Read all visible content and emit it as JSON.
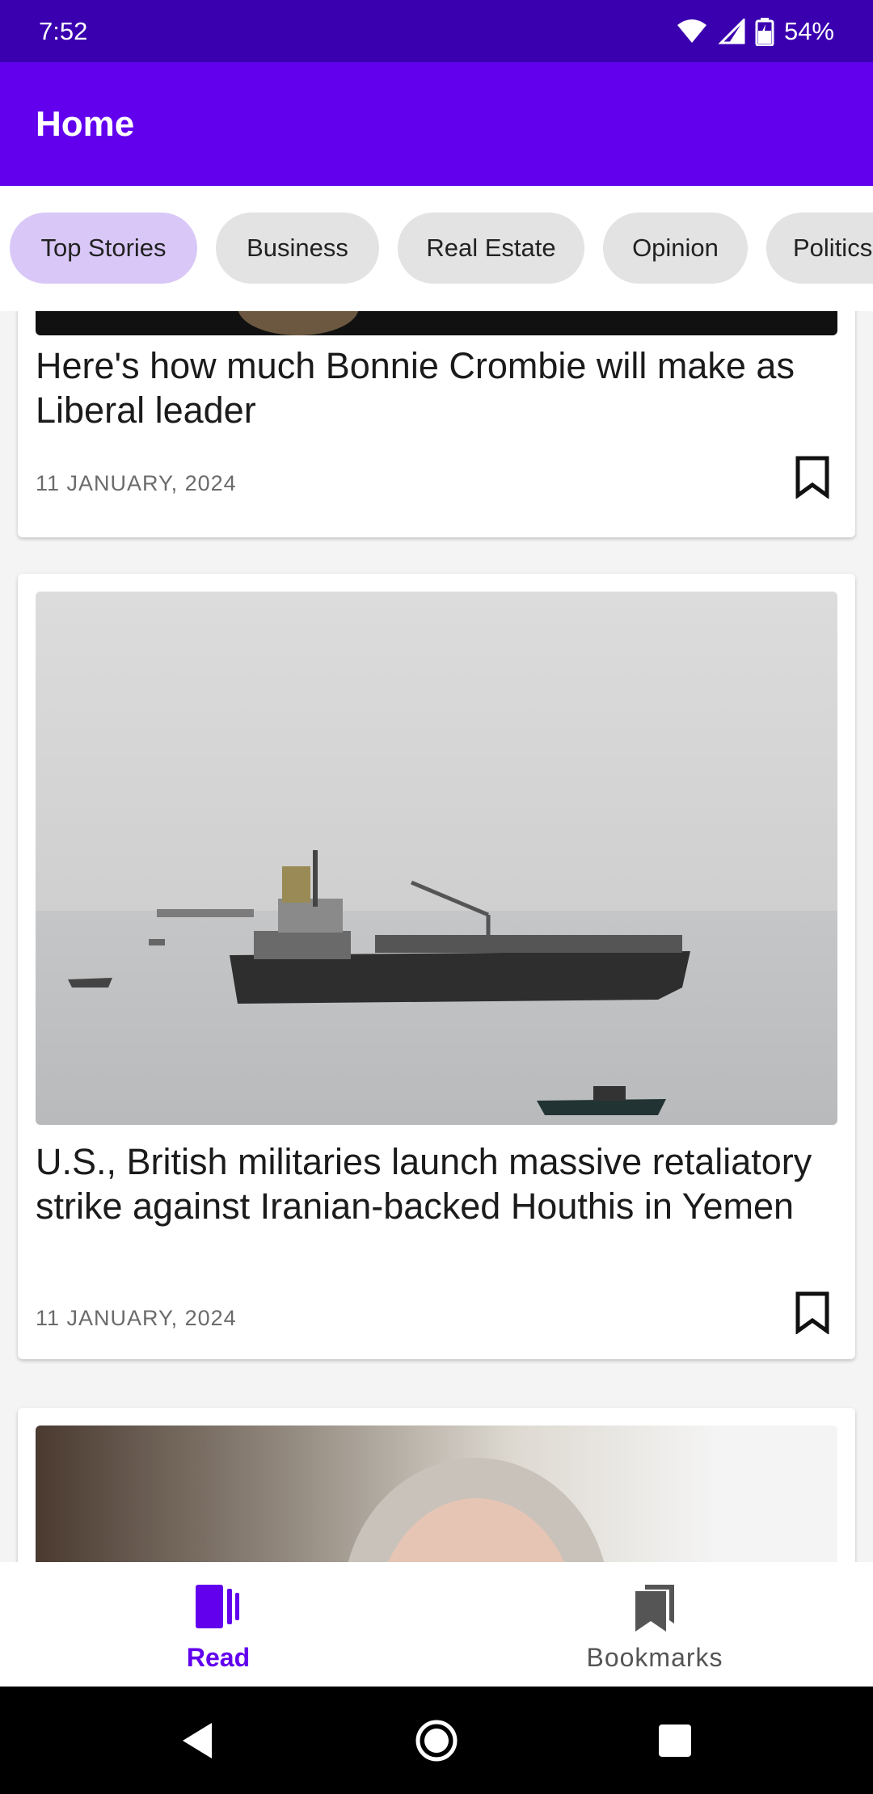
{
  "status_bar": {
    "time": "7:52",
    "battery": "54%"
  },
  "app_bar": {
    "title": "Home"
  },
  "chips": [
    {
      "label": "Top Stories",
      "selected": true
    },
    {
      "label": "Business",
      "selected": false
    },
    {
      "label": "Real Estate",
      "selected": false
    },
    {
      "label": "Opinion",
      "selected": false
    },
    {
      "label": "Politics",
      "selected": false
    }
  ],
  "articles": [
    {
      "headline": "Here's how much Bonnie Crombie will make as Liberal leader",
      "date": "11 JANUARY, 2024"
    },
    {
      "headline": "U.S., British militaries launch massive retaliatory strike against Iranian-backed Houthis in Yemen",
      "date": "11 JANUARY, 2024"
    }
  ],
  "bottom_nav": {
    "read_label": "Read",
    "bookmarks_label": "Bookmarks"
  },
  "colors": {
    "primary": "#6200ee",
    "status_bar": "#3a00b0",
    "chip_selected": "#d9c8f7",
    "chip": "#e3e3e3"
  },
  "icons": [
    "wifi-icon",
    "signal-icon",
    "battery-icon",
    "bookmark-outline-icon",
    "read-icon",
    "bookmarks-icon",
    "back-icon",
    "home-icon",
    "recents-icon"
  ]
}
